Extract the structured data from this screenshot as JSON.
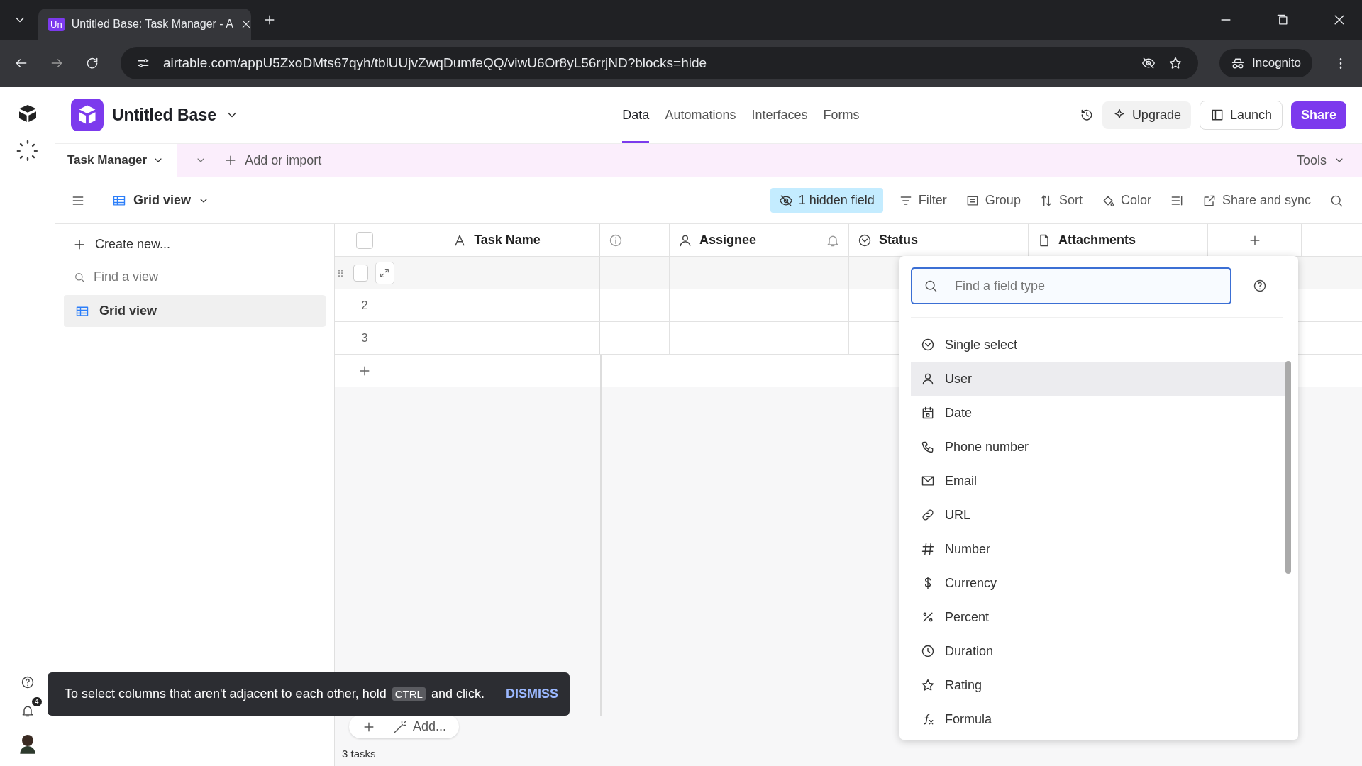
{
  "browser": {
    "tabs": [
      {
        "title": "Untitled Base: Task Manager - A",
        "favicon": "Un",
        "selected": true
      }
    ],
    "url": "airtable.com/appU5ZxoDMts67qyh/tblUUjvZwqDumfeQQ/viwU6Or8yL56rrjND?blocks=hide",
    "incognito": "Incognito"
  },
  "rail": {
    "notification_count": "4"
  },
  "header": {
    "base_name": "Untitled Base",
    "tabs": [
      {
        "label": "Data",
        "selected": true
      },
      {
        "label": "Automations",
        "selected": false
      },
      {
        "label": "Interfaces",
        "selected": false
      },
      {
        "label": "Forms",
        "selected": false
      }
    ],
    "upgrade": "Upgrade",
    "launch": "Launch",
    "share": "Share"
  },
  "table_bar": {
    "table_name": "Task Manager",
    "add_import": "Add or import",
    "tools": "Tools"
  },
  "view_bar": {
    "view_name": "Grid view",
    "hidden_fields": "1 hidden field",
    "actions": [
      {
        "label": "Filter",
        "kind": "filter"
      },
      {
        "label": "Group",
        "kind": "group"
      },
      {
        "label": "Sort",
        "kind": "sort"
      },
      {
        "label": "Color",
        "kind": "color"
      },
      {
        "kind": "rowheight"
      },
      {
        "label": "Share and sync",
        "kind": "share"
      }
    ]
  },
  "sidebar": {
    "create": "Create new...",
    "find_placeholder": "Find a view",
    "views": [
      {
        "label": "Grid view",
        "selected": true
      }
    ]
  },
  "grid": {
    "columns": [
      {
        "name": "Task Name",
        "kind": "text",
        "notifications": false
      },
      {
        "kind": "info",
        "notifications": false
      },
      {
        "name": "Assignee",
        "kind": "user",
        "notifications": true
      },
      {
        "name": "Status",
        "kind": "select",
        "notifications": false
      },
      {
        "name": "Attachments",
        "kind": "attachment",
        "notifications": false
      }
    ],
    "select_all_checked": false,
    "rows": [
      {
        "hovered": true,
        "checked": false
      },
      {
        "number": "2",
        "hovered": false,
        "checked": false
      },
      {
        "number": "3",
        "hovered": false,
        "checked": false
      }
    ],
    "add_label": "Add...",
    "record_count": "3 tasks"
  },
  "field_menu": {
    "placeholder": "Find a field type",
    "items": [
      {
        "label": "Single select",
        "kind": "select",
        "highlighted": false
      },
      {
        "label": "User",
        "kind": "user",
        "highlighted": true
      },
      {
        "label": "Date",
        "kind": "date",
        "highlighted": false
      },
      {
        "label": "Phone number",
        "kind": "phone",
        "highlighted": false
      },
      {
        "label": "Email",
        "kind": "email",
        "highlighted": false
      },
      {
        "label": "URL",
        "kind": "url",
        "highlighted": false
      },
      {
        "label": "Number",
        "kind": "number",
        "highlighted": false
      },
      {
        "label": "Currency",
        "kind": "currency",
        "highlighted": false
      },
      {
        "label": "Percent",
        "kind": "percent",
        "highlighted": false
      },
      {
        "label": "Duration",
        "kind": "duration",
        "highlighted": false
      },
      {
        "label": "Rating",
        "kind": "rating",
        "highlighted": false
      },
      {
        "label": "Formula",
        "kind": "formula",
        "highlighted": false
      }
    ]
  },
  "toast": {
    "text_before": "To select columns that aren't adjacent to each other, hold",
    "key": "CTRL",
    "text_after": "and click.",
    "action": "DISMISS"
  }
}
